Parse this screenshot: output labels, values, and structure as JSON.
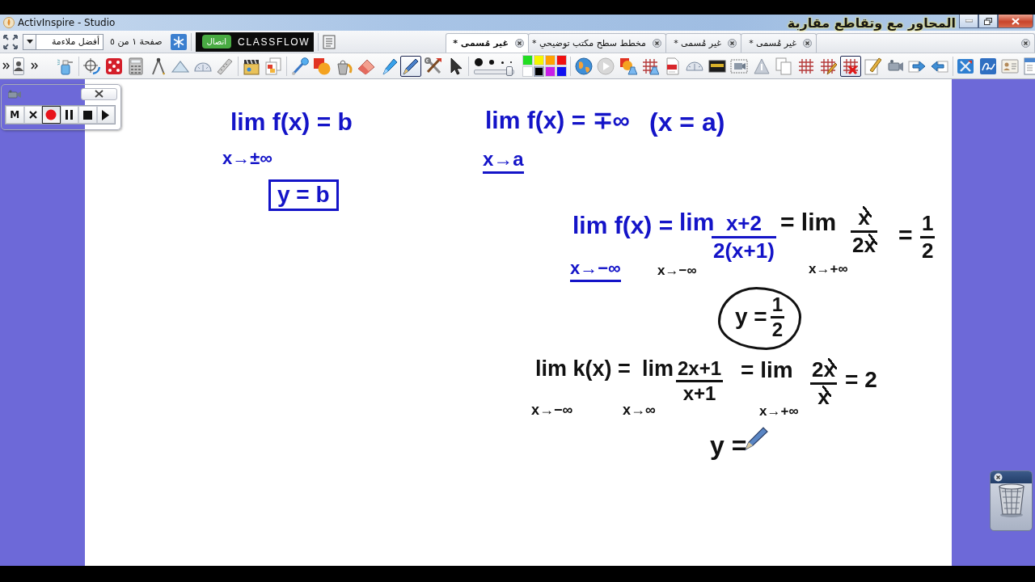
{
  "window": {
    "title": "ActivInspire - Studio"
  },
  "page_bar": {
    "zoom": "أفضل ملاءمة",
    "page_indicator": "صفحة ١ من ٥",
    "classflow": {
      "connect_button": "اتصال",
      "brand": "CLASSFLOW"
    }
  },
  "tabs": [
    {
      "selected": false
    },
    {
      "label": "غير مُسمى *",
      "selected": false
    },
    {
      "label": "غير مُسمى *",
      "selected": false
    },
    {
      "label": "مخطط سطح مكتب توضيحي *",
      "selected": false
    },
    {
      "label": "غير مُسمى *",
      "selected": true
    }
  ],
  "caption": "المحاور مع وتقاطع مقاربة",
  "toolbar": {
    "tools": [
      {
        "selected": false
      },
      {
        "selected": false
      },
      {
        "selected": false
      },
      {
        "selected": false
      },
      {
        "selected": false
      },
      {
        "selected": false
      },
      {
        "selected": false
      },
      {
        "selected": false
      },
      {
        "selected": false
      },
      {
        "selected": false
      },
      {
        "selected": false
      },
      {
        "selected": false
      },
      {
        "selected": false
      },
      {
        "selected": false
      },
      {
        "selected": false
      },
      {
        "selected": true
      },
      {
        "selected": false
      },
      {
        "selected": false
      }
    ],
    "pen_width": {
      "level": 0.9
    },
    "colors": [
      {
        "color": "#22dd22",
        "selected": false
      },
      {
        "color": "#f5f500",
        "selected": false
      },
      {
        "color": "#ffa200",
        "selected": false
      },
      {
        "color": "#f01010",
        "selected": false
      },
      {
        "color": "#ffffff",
        "selected": false
      },
      {
        "color": "#000000",
        "selected": true
      },
      {
        "color": "#c81ee8",
        "selected": false
      },
      {
        "color": "#1010f0",
        "selected": false
      }
    ],
    "page_tools": [
      {
        "selected": false
      },
      {
        "selected": false
      },
      {
        "selected": false
      },
      {
        "selected": false
      },
      {
        "selected": false
      },
      {
        "selected": false
      },
      {
        "selected": false
      },
      {
        "selected": false
      },
      {
        "selected": false
      },
      {
        "selected": false
      },
      {
        "selected": false
      },
      {
        "selected": false
      },
      {
        "selected": true
      },
      {
        "selected": false
      },
      {
        "selected": false
      },
      {
        "selected": false
      },
      {
        "selected": false
      },
      {
        "selected": false
      },
      {
        "selected": false
      },
      {
        "selected": false
      },
      {
        "selected": false
      }
    ]
  },
  "recorder": {
    "buttons": [
      {
        "kind": "label",
        "label": "M",
        "selected": false
      },
      {
        "kind": "cancel",
        "selected": false
      },
      {
        "kind": "record",
        "selected": true
      },
      {
        "kind": "pause",
        "selected": false
      },
      {
        "kind": "stop",
        "selected": false
      },
      {
        "kind": "play",
        "selected": false
      }
    ]
  },
  "ink": [
    {
      "kind": "text",
      "text": "lim f(x) = b",
      "color": "#1414c8",
      "underlined": false
    },
    {
      "kind": "text",
      "text": "x→±∞",
      "color": "#1414c8",
      "underlined": false
    },
    {
      "kind": "boxed",
      "text": "y = b",
      "color": "#1414c8"
    },
    {
      "kind": "text",
      "text": "lim f(x) = ∓∞",
      "color": "#1414c8",
      "underlined": false
    },
    {
      "kind": "text",
      "text": "(x = a)",
      "color": "#1414c8",
      "underlined": false
    },
    {
      "kind": "text",
      "text": "x→a",
      "color": "#1414c8",
      "underlined": true
    },
    {
      "kind": "text",
      "text": "lim f(x) =",
      "color": "#1414c8",
      "underlined": false
    },
    {
      "kind": "text",
      "text": "x→−∞",
      "color": "#1414c8",
      "underlined": true
    },
    {
      "kind": "text",
      "text": "lim",
      "color": "#1414c8",
      "underlined": false
    },
    {
      "kind": "text",
      "text": "x→−∞",
      "color": "#111111",
      "underlined": false
    },
    {
      "kind": "fraction",
      "numerator": "x+2",
      "denominator": "2(x+1)",
      "color": "#1414c8",
      "cancelled": false
    },
    {
      "kind": "text",
      "text": "= lim",
      "color": "#111111",
      "underlined": false
    },
    {
      "kind": "text",
      "text": "x→+∞",
      "color": "#111111",
      "underlined": false
    },
    {
      "kind": "fraction",
      "numerator": "x",
      "denominator": "2x",
      "color": "#111111",
      "cancelled": true
    },
    {
      "kind": "text",
      "text": "=",
      "color": "#111111",
      "underlined": false
    },
    {
      "kind": "fraction",
      "numerator": "1",
      "denominator": "2",
      "color": "#111111",
      "cancelled": false
    },
    {
      "kind": "cloud",
      "text": "y =",
      "numerator": "1",
      "denominator": "2",
      "color": "#111111"
    },
    {
      "kind": "text",
      "text": "lim k(x) =",
      "color": "#111111",
      "underlined": false
    },
    {
      "kind": "text",
      "text": "lim",
      "color": "#111111",
      "underlined": false
    },
    {
      "kind": "text",
      "text": "x→−∞",
      "color": "#111111",
      "underlined": false
    },
    {
      "kind": "text",
      "text": "x→∞",
      "color": "#111111",
      "underlined": false
    },
    {
      "kind": "fraction",
      "numerator": "2x+1",
      "denominator": "x+1",
      "color": "#111111",
      "cancelled": false
    },
    {
      "kind": "text",
      "text": "= lim",
      "color": "#111111",
      "underlined": false
    },
    {
      "kind": "text",
      "text": "x→+∞",
      "color": "#111111",
      "underlined": false
    },
    {
      "kind": "fraction",
      "numerator": "2x",
      "denominator": "x",
      "color": "#111111",
      "cancelled": true
    },
    {
      "kind": "text",
      "text": "= 2",
      "color": "#111111",
      "underlined": false
    },
    {
      "kind": "text",
      "text": "y =",
      "color": "#111111",
      "underlined": false
    }
  ]
}
